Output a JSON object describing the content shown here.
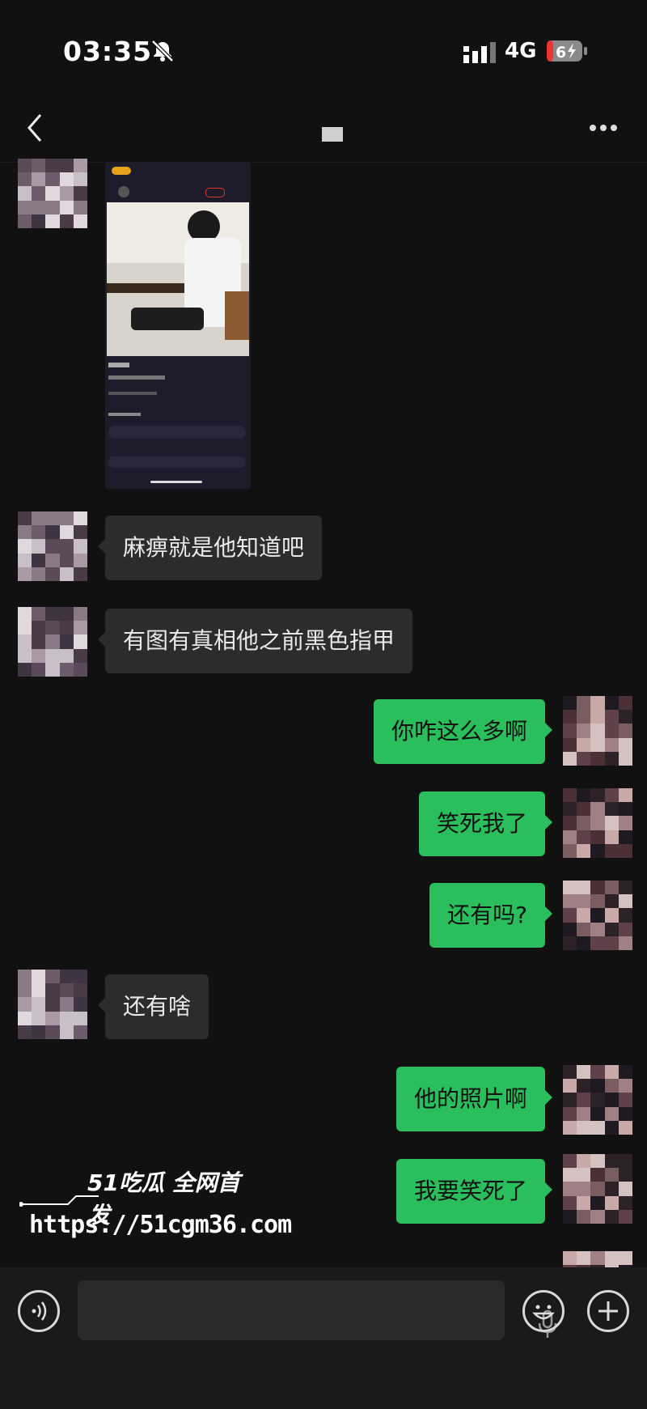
{
  "status_bar": {
    "time": "03:35",
    "network": "4G",
    "battery": "6",
    "icons": [
      "bell-slash-icon",
      "signal-icon",
      "battery-charging-icon"
    ]
  },
  "nav": {
    "back_icon": "chevron-left-icon",
    "more_icon": "ellipsis-icon"
  },
  "colors": {
    "background": "#111111",
    "incoming_bubble": "#2c2c2c",
    "outgoing_bubble": "#2bbe5c"
  },
  "messages": [
    {
      "side": "left",
      "type": "image"
    },
    {
      "side": "left",
      "text": "麻痹就是他知道吧"
    },
    {
      "side": "left",
      "text": "有图有真相他之前黑色指甲"
    },
    {
      "side": "right",
      "text": "你咋这么多啊"
    },
    {
      "side": "right",
      "text": "笑死我了"
    },
    {
      "side": "right",
      "text": "还有吗?"
    },
    {
      "side": "left",
      "text": "还有啥"
    },
    {
      "side": "right",
      "text": "他的照片啊"
    },
    {
      "side": "right",
      "text": "我要笑死了"
    }
  ],
  "watermark": {
    "brand": "51吃瓜 全网首发",
    "url": "https://51cgm36.com"
  },
  "input_bar": {
    "voice_icon": "voice-icon",
    "mic_icon": "microphone-icon",
    "emoji_icon": "emoji-icon",
    "plus_icon": "plus-icon"
  }
}
